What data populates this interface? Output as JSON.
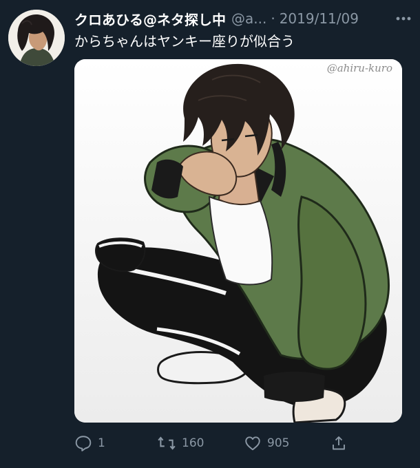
{
  "tweet": {
    "display_name": "クロあひる@ネタ探し中",
    "handle": "@a...",
    "separator": "·",
    "date": "2019/11/09",
    "text": "からちゃんはヤンキー座りが似合う"
  },
  "media": {
    "watermark": "@ahiru-kuro"
  },
  "actions": {
    "replies": "1",
    "retweets": "160",
    "likes": "905"
  },
  "icons": {
    "more": "more-horizontal-icon",
    "reply": "reply-icon",
    "retweet": "retweet-icon",
    "like": "heart-icon",
    "share": "share-icon"
  },
  "colors": {
    "background": "#15202b",
    "secondary_text": "#8b98a5",
    "jacket": "#5d7a4a"
  }
}
